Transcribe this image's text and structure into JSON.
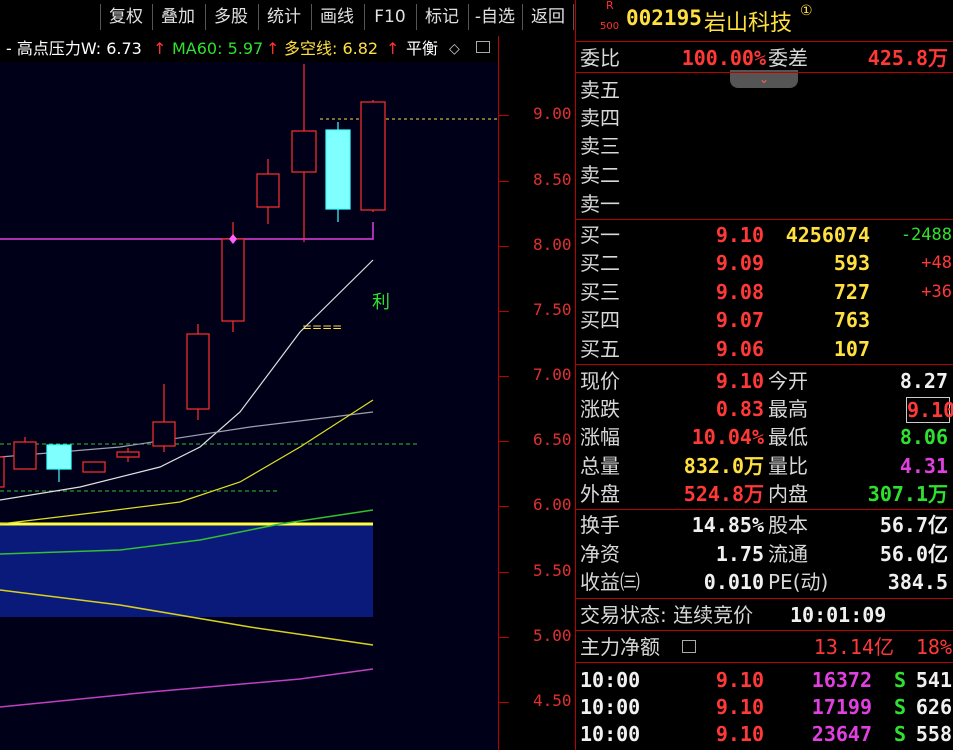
{
  "toolbar": {
    "buttons": [
      "复权",
      "叠加",
      "多股",
      "统计",
      "画线",
      "F10",
      "标记",
      "-自选",
      "返回"
    ]
  },
  "indicator": {
    "hp_label": "- 高点压力W: 6.73",
    "arrow": "↑",
    "ma60_label": "MA60: 5.97",
    "dk_label": "多空线: 6.82",
    "ph_label": "平衡",
    "colors": {
      "hp": "#ffffff",
      "ma60": "#30e030",
      "dk": "#ffe040",
      "arrow": "#ff3030"
    }
  },
  "chart_markers": {
    "li": "利",
    "dash": "===="
  },
  "yaxis": [
    "9.00",
    "8.50",
    "8.00",
    "7.50",
    "7.00",
    "6.50",
    "6.00",
    "5.50",
    "5.00",
    "4.50"
  ],
  "stock": {
    "badge_top": "R",
    "badge_bottom": "500",
    "code": "002195",
    "name": "岩山科技",
    "circle": "①"
  },
  "weibi": {
    "label1": "委比",
    "value1": "100.00%",
    "label2": "委差",
    "value2": "425.8万"
  },
  "sell": [
    {
      "label": "卖五"
    },
    {
      "label": "卖四"
    },
    {
      "label": "卖三"
    },
    {
      "label": "卖二"
    },
    {
      "label": "卖一"
    }
  ],
  "buy": [
    {
      "label": "买一",
      "price": "9.10",
      "vol": "4256074",
      "chg": "-2488"
    },
    {
      "label": "买二",
      "price": "9.09",
      "vol": "593",
      "chg": "+48"
    },
    {
      "label": "买三",
      "price": "9.08",
      "vol": "727",
      "chg": "+36"
    },
    {
      "label": "买四",
      "price": "9.07",
      "vol": "763",
      "chg": ""
    },
    {
      "label": "买五",
      "price": "9.06",
      "vol": "107",
      "chg": ""
    }
  ],
  "quote": {
    "xianjia_l": "现价",
    "xianjia": "9.10",
    "jinkai_l": "今开",
    "jinkai": "8.27",
    "zhangdie_l": "涨跌",
    "zhangdie": "0.83",
    "zuigao_l": "最高",
    "zuigao": "9.10",
    "zhangfu_l": "涨幅",
    "zhangfu": "10.04%",
    "zuidi_l": "最低",
    "zuidi": "8.06",
    "zongliang_l": "总量",
    "zongliang": "832.0万",
    "liangbi_l": "量比",
    "liangbi": "4.31",
    "waipan_l": "外盘",
    "waipan": "524.8万",
    "neipan_l": "内盘",
    "neipan": "307.1万"
  },
  "fund": {
    "huanshou_l": "换手",
    "huanshou": "14.85%",
    "guben_l": "股本",
    "guben": "56.7亿",
    "jingzi_l": "净资",
    "jingzi": "1.75",
    "liutong_l": "流通",
    "liutong": "56.0亿",
    "shouyi_l": "收益㈢",
    "shouyi": "0.010",
    "pe_l": "PE(动)",
    "pe": "384.5"
  },
  "status": {
    "label": "交易状态: 连续竞价",
    "time": "10:01:09"
  },
  "zhuli": {
    "label": "主力净额",
    "value": "13.14亿",
    "pct": "18%"
  },
  "ticks": [
    {
      "time": "10:00",
      "price": "9.10",
      "vol": "16372",
      "side": "S",
      "num": "541"
    },
    {
      "time": "10:00",
      "price": "9.10",
      "vol": "17199",
      "side": "S",
      "num": "626"
    },
    {
      "time": "10:00",
      "price": "9.10",
      "vol": "23647",
      "side": "S",
      "num": "558"
    }
  ]
}
